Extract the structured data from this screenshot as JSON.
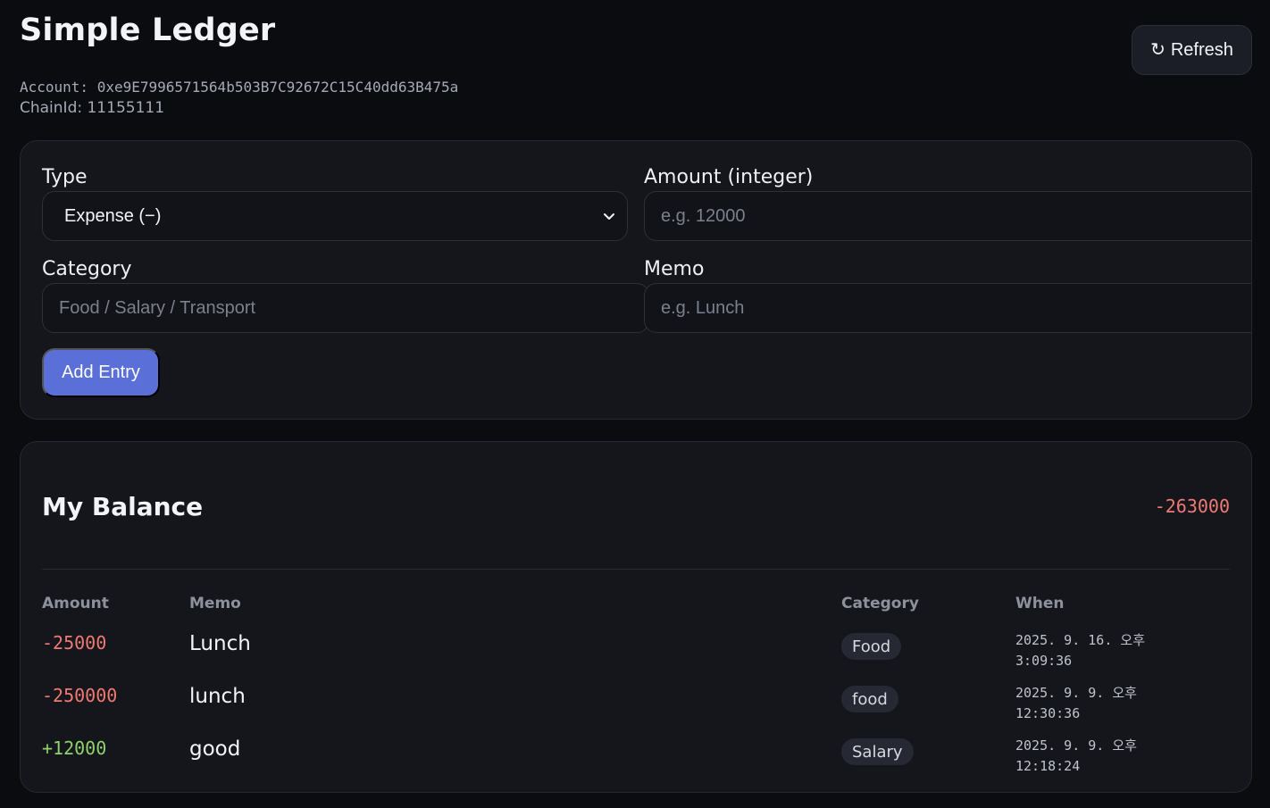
{
  "header": {
    "title": "Simple Ledger",
    "account": "Account: 0xe9E7996571564b503B7C92672C15C40dd63B475a",
    "chain": "ChainId: 11155111",
    "refresh_icon": "↻",
    "refresh_label": "Refresh"
  },
  "form": {
    "type_label": "Type",
    "type_value": "Expense (−)",
    "amount_label": "Amount (integer)",
    "amount_placeholder": "e.g. 12000",
    "category_label": "Category",
    "category_placeholder": "Food / Salary / Transport",
    "memo_label": "Memo",
    "memo_placeholder": "e.g. Lunch",
    "add_label": "Add Entry"
  },
  "balance": {
    "title": "My Balance",
    "value": "-263000",
    "columns": {
      "amount": "Amount",
      "memo": "Memo",
      "category": "Category",
      "when": "When"
    },
    "entries": [
      {
        "amount": "-25000",
        "memo": "Lunch",
        "category": "Food",
        "when_date": "2025. 9. 16. 오후",
        "when_time": "3:09:36"
      },
      {
        "amount": "-250000",
        "memo": "lunch",
        "category": "food",
        "when_date": "2025. 9. 9. 오후",
        "when_time": "12:30:36"
      },
      {
        "amount": "+12000",
        "memo": "good",
        "category": "Salary",
        "when_date": "2025. 9. 9. 오후",
        "when_time": "12:18:24"
      }
    ]
  },
  "colors": {
    "background": "#0b0c10",
    "card": "#14161b",
    "accent": "#5b6fd8",
    "negative": "#ef7a73",
    "positive": "#8fd16a"
  }
}
